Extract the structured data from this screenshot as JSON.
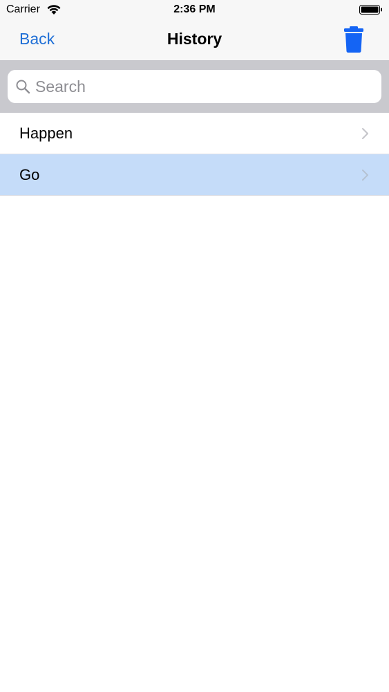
{
  "status_bar": {
    "carrier": "Carrier",
    "time": "2:36 PM",
    "icons": [
      "wifi-icon",
      "battery-icon"
    ]
  },
  "nav_bar": {
    "back_label": "Back",
    "title": "History",
    "right_icon": "trash-icon"
  },
  "search": {
    "placeholder": "Search",
    "value": ""
  },
  "history_items": [
    {
      "label": "Happen",
      "selected": false
    },
    {
      "label": "Go",
      "selected": true
    }
  ],
  "colors": {
    "accent": "#1f6fd6",
    "trash": "#1464f4",
    "selected_row": "#c5dcf9",
    "search_bar_bg": "#c9c9ce"
  }
}
